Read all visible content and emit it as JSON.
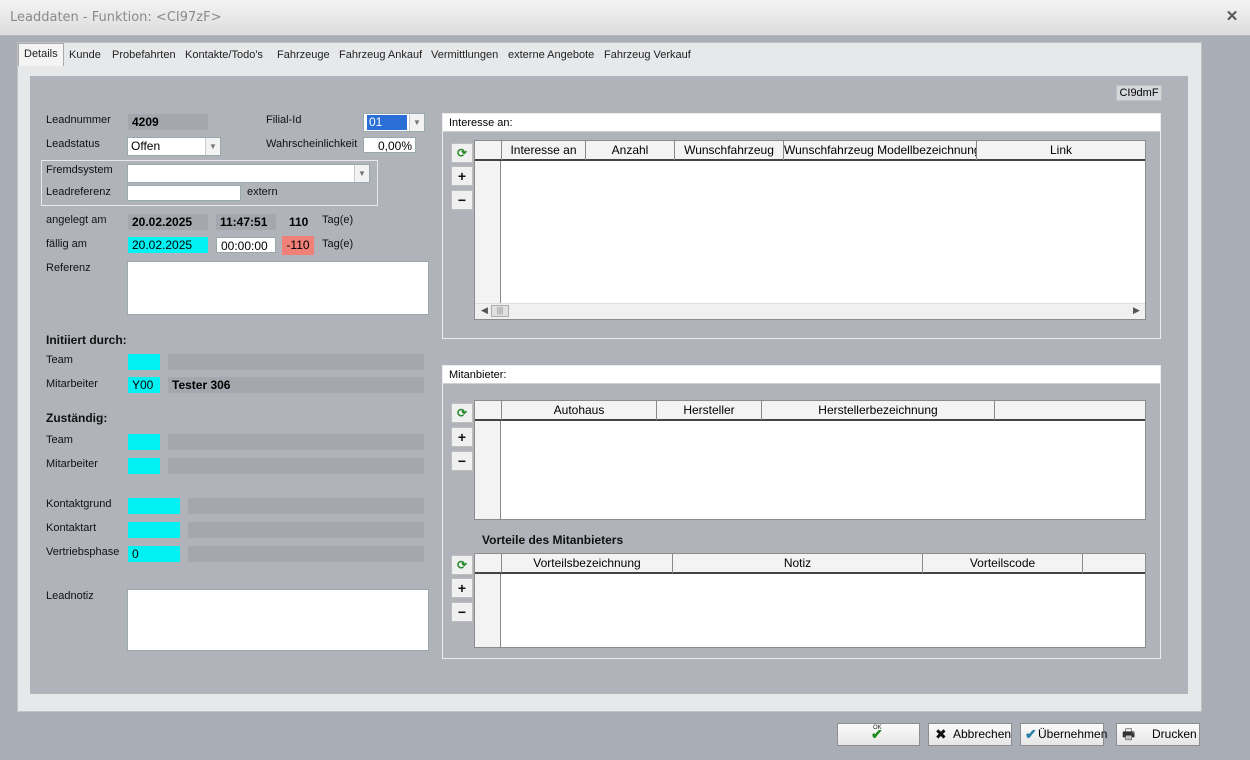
{
  "window": {
    "title": "Leaddaten - Funktion: <CI97zF>",
    "close_glyph": "✕"
  },
  "tabs": [
    "Details",
    "Kunde",
    "Probefahrten",
    "Kontakte/Todo's",
    "Fahrzeuge",
    "Fahrzeug Ankauf",
    "Vermittlungen",
    "externe Angebote",
    "Fahrzeug Verkauf"
  ],
  "corner_label": "CI9dmF",
  "lead": {
    "leadnummer_label": "Leadnummer",
    "leadnummer": "4209",
    "filial_label": "Filial-Id",
    "filial": "01",
    "leadstatus_label": "Leadstatus",
    "leadstatus": "Offen",
    "wahrscheinlichkeit_label": "Wahrscheinlichkeit",
    "wahrscheinlichkeit": "0,00%",
    "fremdsystem_label": "Fremdsystem",
    "fremdsystem": "",
    "leadreferenz_label": "Leadreferenz",
    "leadreferenz": "",
    "extern_label": "extern",
    "angelegt_label": "angelegt am",
    "angelegt_datum": "20.02.2025",
    "angelegt_zeit": "11:47:51",
    "angelegt_tage": "110",
    "tage_label": "Tag(e)",
    "faellig_label": "fällig am",
    "faellig_datum": "20.02.2025",
    "faellig_zeit": "00:00:00",
    "faellig_tage": "-110",
    "referenz_label": "Referenz",
    "referenz": ""
  },
  "initiiert": {
    "header": "Initiiert durch:",
    "team_label": "Team",
    "team_code": "",
    "team_name": "",
    "mitarbeiter_label": "Mitarbeiter",
    "mitarbeiter_code": "Y00",
    "mitarbeiter_name": "Tester 306"
  },
  "zustaendig": {
    "header": "Zuständig:",
    "team_label": "Team",
    "team_code": "",
    "team_name": "",
    "mitarbeiter_label": "Mitarbeiter",
    "mitarbeiter_code": "",
    "mitarbeiter_name": ""
  },
  "kontakt": {
    "kontaktgrund_label": "Kontaktgrund",
    "kontaktgrund_code": "",
    "kontaktart_label": "Kontaktart",
    "kontaktart_code": "",
    "vertriebsphase_label": "Vertriebsphase",
    "vertriebsphase_code": "0"
  },
  "leadnotiz": {
    "label": "Leadnotiz",
    "value": ""
  },
  "interesse": {
    "title": "Interesse an:",
    "columns": [
      "Interesse an",
      "Anzahl",
      "Wunschfahrzeug",
      "Wunschfahrzeug Modellbezeichnung",
      "Link"
    ],
    "scroll_thumb": "|||"
  },
  "mitanbieter": {
    "title": "Mitanbieter:",
    "columns": [
      "Autohaus",
      "Hersteller",
      "Herstellerbezeichnung"
    ],
    "vorteile_header": "Vorteile des Mitanbieters",
    "vorteile_columns": [
      "Vorteilsbezeichnung",
      "Notiz",
      "Vorteilscode"
    ]
  },
  "side_buttons": {
    "refresh": "⟳",
    "add": "+",
    "remove": "−"
  },
  "buttons": {
    "ok_icon": "✔",
    "ok_icon_text": "OK",
    "abbrechen": "Abbrechen",
    "abbrechen_icon": "✖",
    "uebernehmen": "Übernehmen",
    "uebernehmen_icon": "✔",
    "drucken": "Drucken",
    "drucken_icon": "🖶"
  },
  "colors": {
    "cyan": "#00f2f2",
    "red": "#f08078",
    "content_bg": "#b0b3ba"
  }
}
